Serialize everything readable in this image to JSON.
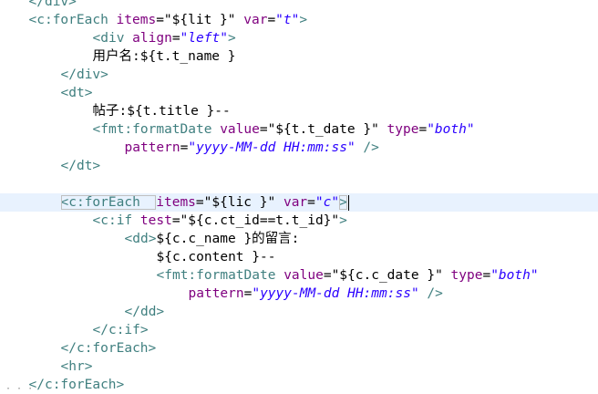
{
  "editor": {
    "language": "jsp",
    "current_line_index": 10,
    "lines": [
      {
        "indent": 2,
        "tokens": [
          {
            "t": "tag",
            "v": "</div>"
          }
        ],
        "cut_top": true
      },
      {
        "indent": 2,
        "tokens": [
          {
            "t": "tag",
            "v": "<c:forEach "
          },
          {
            "t": "attr",
            "v": "items"
          },
          {
            "t": "plain",
            "v": "="
          },
          {
            "t": "plain",
            "v": "\"${lit }\""
          },
          {
            "t": "plain",
            "v": " "
          },
          {
            "t": "attr",
            "v": "var"
          },
          {
            "t": "plain",
            "v": "="
          },
          {
            "t": "val",
            "v": "\"t\""
          },
          {
            "t": "tag",
            "v": ">"
          }
        ]
      },
      {
        "indent": 10,
        "tokens": [
          {
            "t": "tag",
            "v": "<div "
          },
          {
            "t": "attr",
            "v": "align"
          },
          {
            "t": "plain",
            "v": "="
          },
          {
            "t": "val",
            "v": "\"left\""
          },
          {
            "t": "tag",
            "v": ">"
          }
        ]
      },
      {
        "indent": 10,
        "tokens": [
          {
            "t": "plain",
            "v": "用户名:${t.t_name }"
          }
        ]
      },
      {
        "indent": 6,
        "tokens": [
          {
            "t": "tag",
            "v": "</div>"
          }
        ]
      },
      {
        "indent": 6,
        "tokens": [
          {
            "t": "tag",
            "v": "<dt>"
          }
        ]
      },
      {
        "indent": 10,
        "tokens": [
          {
            "t": "plain",
            "v": "帖子:${t.title }--"
          }
        ]
      },
      {
        "indent": 10,
        "tokens": [
          {
            "t": "tag",
            "v": "<fmt:formatDate "
          },
          {
            "t": "attr",
            "v": "value"
          },
          {
            "t": "plain",
            "v": "="
          },
          {
            "t": "plain",
            "v": "\"${t.t_date }\""
          },
          {
            "t": "plain",
            "v": " "
          },
          {
            "t": "attr",
            "v": "type"
          },
          {
            "t": "plain",
            "v": "="
          },
          {
            "t": "val",
            "v": "\"both\""
          }
        ]
      },
      {
        "indent": 14,
        "tokens": [
          {
            "t": "attr",
            "v": "pattern"
          },
          {
            "t": "plain",
            "v": "="
          },
          {
            "t": "val",
            "v": "\"yyyy-MM-dd HH:mm:ss\""
          },
          {
            "t": "plain",
            "v": " "
          },
          {
            "t": "tag",
            "v": "/>"
          }
        ]
      },
      {
        "indent": 6,
        "tokens": [
          {
            "t": "tag",
            "v": "</dt>"
          }
        ]
      },
      {
        "indent": 0,
        "tokens": []
      },
      {
        "indent": 6,
        "tokens": [
          {
            "t": "tag",
            "v": "<c:forEach  "
          },
          {
            "t": "attr",
            "v": "items"
          },
          {
            "t": "plain",
            "v": "="
          },
          {
            "t": "plain",
            "v": "\"${lic }\""
          },
          {
            "t": "plain",
            "v": " "
          },
          {
            "t": "attr",
            "v": "var"
          },
          {
            "t": "plain",
            "v": "="
          },
          {
            "t": "val",
            "v": "\"c\""
          },
          {
            "t": "tag",
            "v": ">"
          }
        ],
        "current": true
      },
      {
        "indent": 10,
        "tokens": [
          {
            "t": "tag",
            "v": "<c:if "
          },
          {
            "t": "attr",
            "v": "test"
          },
          {
            "t": "plain",
            "v": "="
          },
          {
            "t": "plain",
            "v": "\"${c.ct_id==t.t_id}\""
          },
          {
            "t": "tag",
            "v": ">"
          }
        ]
      },
      {
        "indent": 14,
        "tokens": [
          {
            "t": "tag",
            "v": "<dd>"
          },
          {
            "t": "plain",
            "v": "${c.c_name }的留言:"
          }
        ]
      },
      {
        "indent": 18,
        "tokens": [
          {
            "t": "plain",
            "v": "${c.content }--"
          }
        ]
      },
      {
        "indent": 18,
        "tokens": [
          {
            "t": "tag",
            "v": "<fmt:formatDate "
          },
          {
            "t": "attr",
            "v": "value"
          },
          {
            "t": "plain",
            "v": "="
          },
          {
            "t": "plain",
            "v": "\"${c.c_date }\""
          },
          {
            "t": "plain",
            "v": " "
          },
          {
            "t": "attr",
            "v": "type"
          },
          {
            "t": "plain",
            "v": "="
          },
          {
            "t": "val",
            "v": "\"both\""
          }
        ]
      },
      {
        "indent": 22,
        "tokens": [
          {
            "t": "attr",
            "v": "pattern"
          },
          {
            "t": "plain",
            "v": "="
          },
          {
            "t": "val",
            "v": "\"yyyy-MM-dd HH:mm:ss\""
          },
          {
            "t": "plain",
            "v": " "
          },
          {
            "t": "tag",
            "v": "/>"
          }
        ]
      },
      {
        "indent": 14,
        "tokens": [
          {
            "t": "tag",
            "v": "</dd>"
          }
        ]
      },
      {
        "indent": 10,
        "tokens": [
          {
            "t": "tag",
            "v": "</c:if>"
          }
        ]
      },
      {
        "indent": 6,
        "tokens": [
          {
            "t": "tag",
            "v": "</c:forEach>"
          }
        ]
      },
      {
        "indent": 6,
        "tokens": [
          {
            "t": "tag",
            "v": "<hr>"
          }
        ]
      },
      {
        "indent": 2,
        "tokens": [
          {
            "t": "tag",
            "v": "</c:forEach>"
          }
        ]
      }
    ]
  }
}
